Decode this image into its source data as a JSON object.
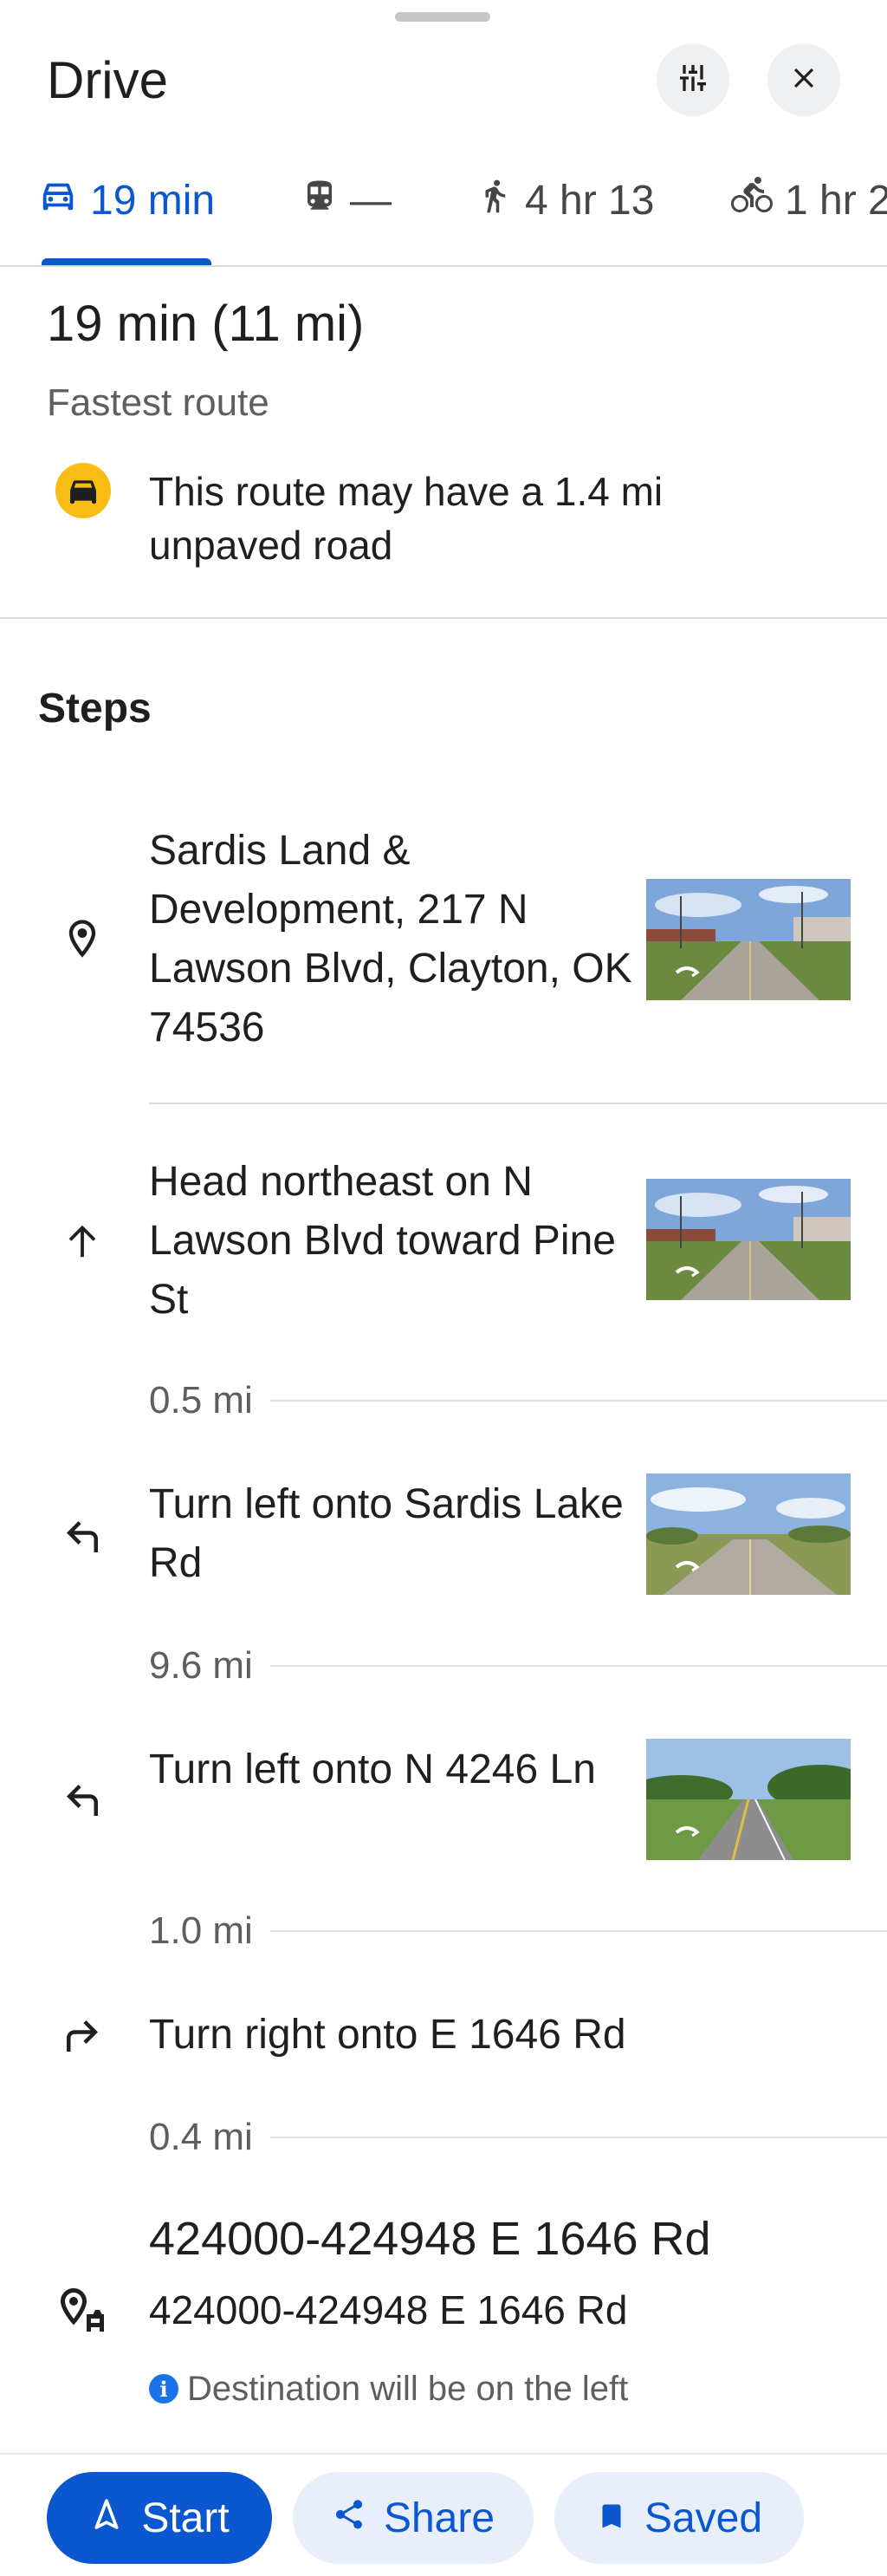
{
  "header": {
    "title": "Drive",
    "options_icon": "tune-icon",
    "close_icon": "close-icon"
  },
  "tabs": [
    {
      "mode": "drive",
      "icon": "car-icon",
      "label": "19 min",
      "active": true
    },
    {
      "mode": "transit",
      "icon": "train-icon",
      "label": "—",
      "active": false
    },
    {
      "mode": "walk",
      "icon": "walk-icon",
      "label": "4 hr 13",
      "active": false
    },
    {
      "mode": "bike",
      "icon": "bike-icon",
      "label": "1 hr 2",
      "active": false
    }
  ],
  "summary": {
    "time": "19 min (11 mi)",
    "subtitle": "Fastest route",
    "warning_icon": "car-warning-icon",
    "warning": "This route may have a 1.4 mi unpaved road"
  },
  "steps_title": "Steps",
  "steps": [
    {
      "icon": "place-pin-icon",
      "text": "Sardis Land & Development, 217 N Lawson Blvd, Clayton, OK 74536",
      "has_thumb": true
    },
    {
      "icon": "arrow-up-icon",
      "text": "Head northeast on N Lawson Blvd toward Pine St",
      "has_thumb": true,
      "distance": "0.5 mi"
    },
    {
      "icon": "turn-left-icon",
      "text": "Turn left onto Sardis Lake Rd",
      "has_thumb": true,
      "distance": "9.6 mi"
    },
    {
      "icon": "turn-left-icon",
      "text": "Turn left onto N 4246 Ln",
      "has_thumb": true,
      "distance": "1.0 mi"
    },
    {
      "icon": "turn-right-icon",
      "text": "Turn right onto E 1646 Rd",
      "has_thumb": false,
      "distance": "0.4 mi"
    }
  ],
  "destination": {
    "icon": "destination-pin-icon",
    "title": "424000-424948 E 1646 Rd",
    "address": "424000-424948 E 1646 Rd",
    "note_icon": "info-icon",
    "note": "Destination will be on the left"
  },
  "actions": {
    "start": "Start",
    "share": "Share",
    "saved": "Saved"
  },
  "colors": {
    "accent": "#0b57d0",
    "tonal_bg": "#e8effa",
    "warning": "#f9bc15"
  }
}
